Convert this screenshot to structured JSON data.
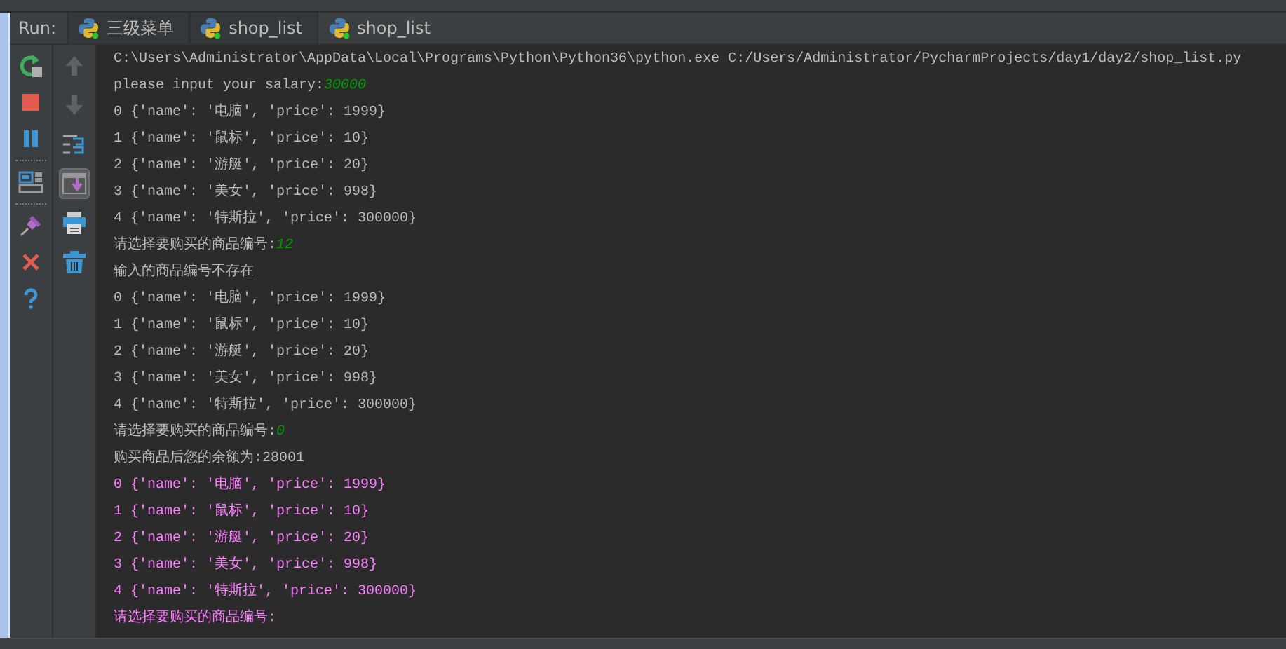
{
  "run_bar": {
    "label": "Run:",
    "tabs": [
      {
        "label": "三级菜单",
        "selected": false
      },
      {
        "label": "shop_list",
        "selected": false
      },
      {
        "label": "shop_list",
        "selected": true
      }
    ]
  },
  "toolbar": {
    "left": [
      {
        "kind": "rerun"
      },
      {
        "kind": "stop"
      },
      {
        "kind": "pause"
      },
      {
        "kind": "separator"
      },
      {
        "kind": "layout"
      },
      {
        "kind": "separator"
      },
      {
        "kind": "pin"
      },
      {
        "kind": "close"
      },
      {
        "kind": "help"
      }
    ],
    "right": [
      {
        "kind": "up",
        "disabled": true
      },
      {
        "kind": "down",
        "disabled": true
      },
      {
        "kind": "wrap",
        "selected": false
      },
      {
        "kind": "scroll-end",
        "selected": true
      },
      {
        "kind": "print",
        "selected": false
      },
      {
        "kind": "trash",
        "selected": false
      }
    ]
  },
  "console": {
    "lines": [
      {
        "kind": "system",
        "text": "C:\\Users\\Administrator\\AppData\\Local\\Programs\\Python\\Python36\\python.exe C:/Users/Administrator/PycharmProjects/day1/day2/shop_list.py"
      },
      {
        "kind": "stdout",
        "text": "please input your salary:",
        "input": "30000"
      },
      {
        "kind": "stdout",
        "text": "0 {'name': '电脑', 'price': 1999}"
      },
      {
        "kind": "stdout",
        "text": "1 {'name': '鼠标', 'price': 10}"
      },
      {
        "kind": "stdout",
        "text": "2 {'name': '游艇', 'price': 20}"
      },
      {
        "kind": "stdout",
        "text": "3 {'name': '美女', 'price': 998}"
      },
      {
        "kind": "stdout",
        "text": "4 {'name': '特斯拉', 'price': 300000}"
      },
      {
        "kind": "stdout",
        "text": "请选择要购买的商品编号:",
        "input": "12"
      },
      {
        "kind": "stdout",
        "text": "输入的商品编号不存在"
      },
      {
        "kind": "stdout",
        "text": "0 {'name': '电脑', 'price': 1999}"
      },
      {
        "kind": "stdout",
        "text": "1 {'name': '鼠标', 'price': 10}"
      },
      {
        "kind": "stdout",
        "text": "2 {'name': '游艇', 'price': 20}"
      },
      {
        "kind": "stdout",
        "text": "3 {'name': '美女', 'price': 998}"
      },
      {
        "kind": "stdout",
        "text": "4 {'name': '特斯拉', 'price': 300000}"
      },
      {
        "kind": "stdout",
        "text": "请选择要购买的商品编号:",
        "input": "0"
      },
      {
        "kind": "stdout",
        "text": "购买商品后您的余额为:28001"
      },
      {
        "kind": "stderr",
        "text": "0 {'name': '电脑', 'price': 1999}"
      },
      {
        "kind": "stderr",
        "text": "1 {'name': '鼠标', 'price': 10}"
      },
      {
        "kind": "stderr",
        "text": "2 {'name': '游艇', 'price': 20}"
      },
      {
        "kind": "stderr",
        "text": "3 {'name': '美女', 'price': 998}"
      },
      {
        "kind": "stderr",
        "text": "4 {'name': '特斯拉', 'price': 300000}"
      },
      {
        "kind": "stderr",
        "text": "请选择要购买的商品编号:"
      }
    ]
  }
}
